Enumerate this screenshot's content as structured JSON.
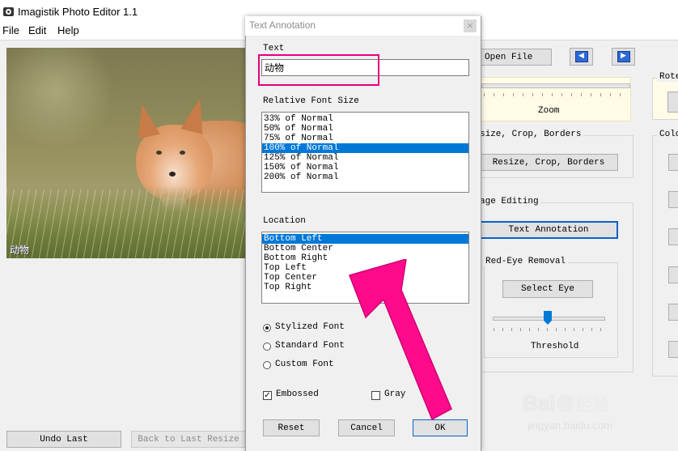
{
  "app": {
    "title": "Imagistik Photo Editor 1.1",
    "menu": [
      "File",
      "Edit",
      "Help"
    ],
    "image_caption": "动物",
    "undo_label": "Undo Last",
    "back_resize_label": "Back to Last Resize",
    "open_file_label": "Open File",
    "zoom_label": "Zoom",
    "resize_group_title": "size, Crop, Borders",
    "resize_button_label": "Resize, Crop, Borders",
    "editing_group_title": "age Editing",
    "text_annotation_label": "Text Annotation",
    "redeye_group_title": "Red-Eye Removal",
    "select_eye_label": "Select Eye",
    "threshold_label": "Threshold",
    "rotate_group_title": "Rote",
    "color_group_title": "Colo"
  },
  "dialog": {
    "title": "Text Annotation",
    "text_label": "Text",
    "text_value": "动物",
    "font_size_label": "Relative Font Size",
    "font_sizes": [
      "33% of Normal",
      "50% of Normal",
      "75% of Normal",
      "100% of Normal",
      "125% of Normal",
      "150% of Normal",
      "200% of Normal"
    ],
    "font_size_selected": "100% of Normal",
    "location_label": "Location",
    "locations": [
      "Bottom Left",
      "Bottom Center",
      "Bottom Right",
      "Top Left",
      "Top Center",
      "Top Right"
    ],
    "location_selected": "Bottom Left",
    "fonts": {
      "stylized": "Stylized Font",
      "standard": "Standard Font",
      "custom": "Custom Font"
    },
    "font_selected": "Stylized Font",
    "embossed_label": "Embossed",
    "embossed_checked": true,
    "gray_label": "Gray",
    "gray_checked": false,
    "reset_label": "Reset",
    "cancel_label": "Cancel",
    "ok_label": "OK"
  },
  "watermark": {
    "brand": "Bai",
    "brand2": "经验",
    "url": "jingyan.baidu.com"
  },
  "colors": {
    "accent": "#0078d7",
    "highlight_box": "#e6007e",
    "arrow": "#ff0a8c"
  }
}
